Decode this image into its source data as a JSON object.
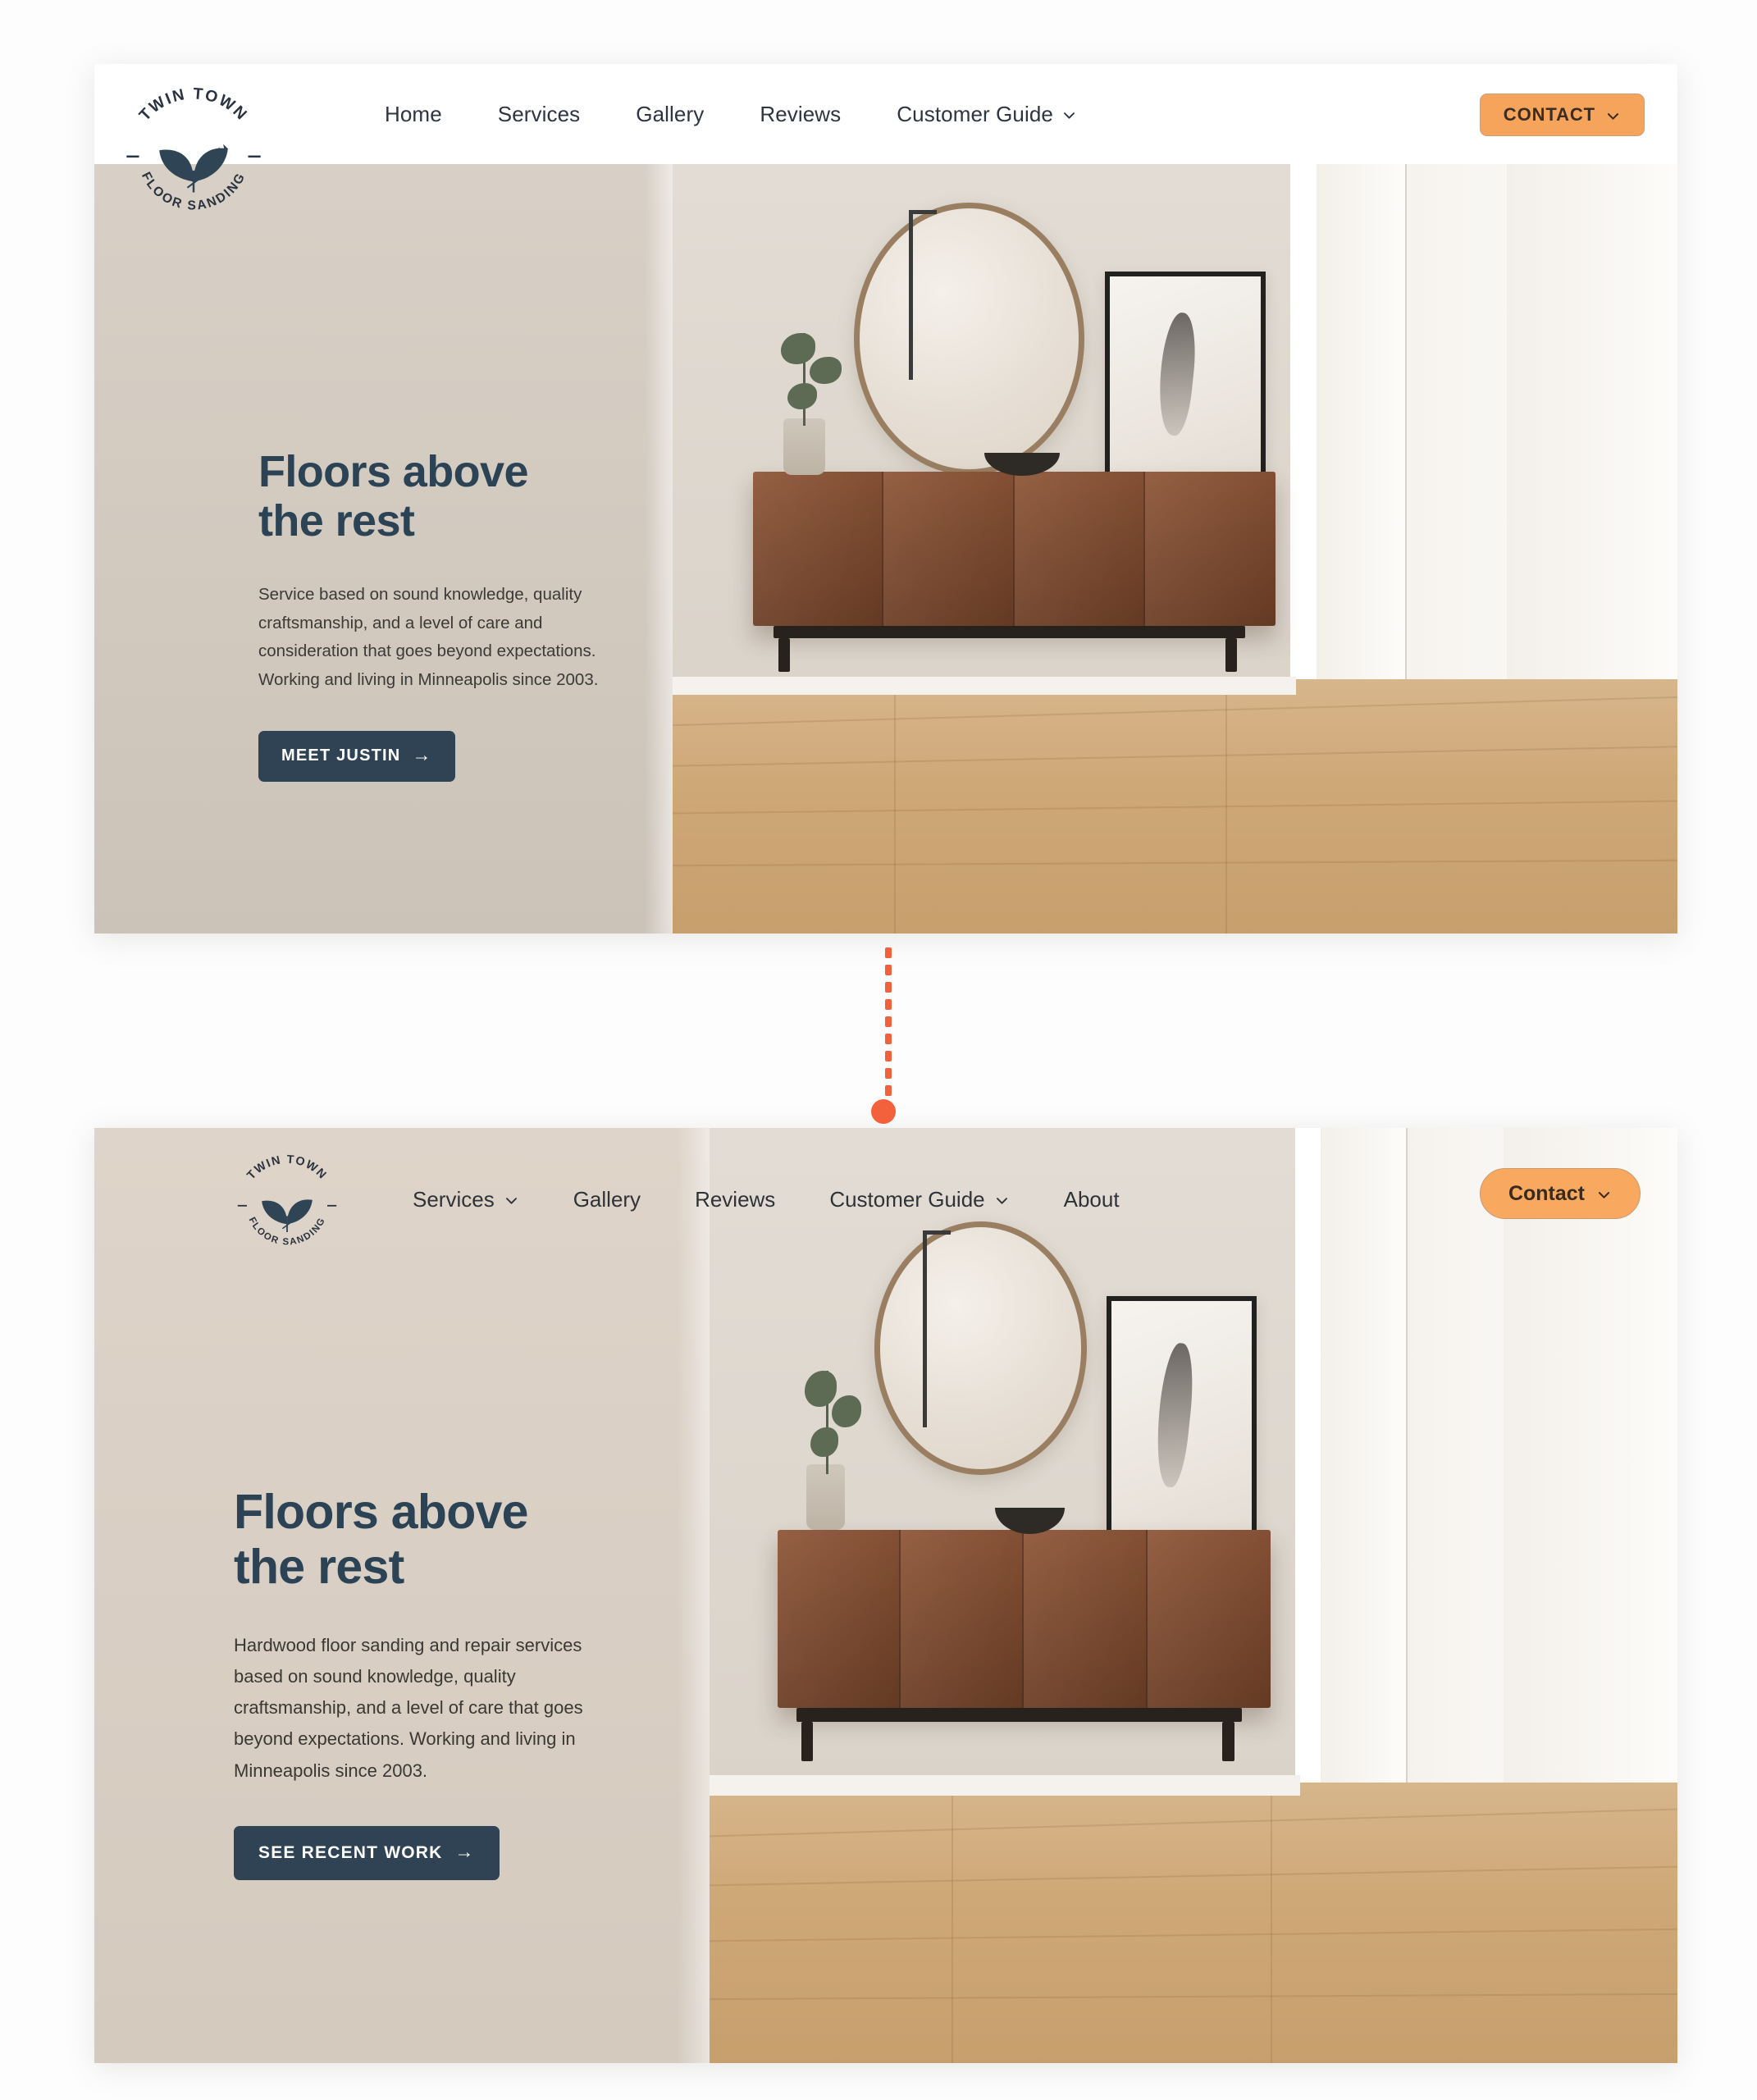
{
  "brand": {
    "name_top": "TWIN TOWN",
    "name_bottom": "FLOOR SANDING",
    "logo_icon": "leaf-emblem-icon"
  },
  "colors": {
    "page_background": "#fdfdfd",
    "heading": "#2c4356",
    "dark_button": "#2f4355",
    "accent_orange": "#f6a35b",
    "connector_orange": "#f2603c",
    "panel_beige": "#d8d0c6"
  },
  "section_top": {
    "nav": {
      "items": [
        {
          "label": "Home",
          "has_dropdown": false
        },
        {
          "label": "Services",
          "has_dropdown": false
        },
        {
          "label": "Gallery",
          "has_dropdown": false
        },
        {
          "label": "Reviews",
          "has_dropdown": false
        },
        {
          "label": "Customer Guide",
          "has_dropdown": true
        }
      ],
      "cta": {
        "label": "CONTACT",
        "has_dropdown": true,
        "icon": "chevron-down-icon"
      }
    },
    "hero": {
      "title_line1": "Floors above",
      "title_line2": "the rest",
      "paragraph": "Service based on sound knowledge, quality craftsmanship, and a level of care and consideration that goes beyond expectations. Working and living in Minneapolis since 2003.",
      "cta_label": "MEET JUSTIN",
      "cta_icon": "arrow-right-icon"
    }
  },
  "connector": {
    "style": "dotted-vertical-line",
    "end_marker": "filled-circle",
    "color": "#f2603c"
  },
  "section_bottom": {
    "nav": {
      "items": [
        {
          "label": "Services",
          "has_dropdown": true
        },
        {
          "label": "Gallery",
          "has_dropdown": false
        },
        {
          "label": "Reviews",
          "has_dropdown": false
        },
        {
          "label": "Customer Guide",
          "has_dropdown": true
        },
        {
          "label": "About",
          "has_dropdown": false
        }
      ],
      "cta": {
        "label": "Contact",
        "has_dropdown": true,
        "icon": "chevron-down-icon"
      }
    },
    "hero": {
      "title_line1": "Floors above",
      "title_line2": "the rest",
      "paragraph": "Hardwood floor sanding and repair services based on sound knowledge, quality craftsmanship, and a level of care that goes beyond expectations. Working and living in Minneapolis since 2003.",
      "cta_label": "SEE RECENT WORK",
      "cta_icon": "arrow-right-icon"
    }
  },
  "photo": {
    "alt": "hallway-interior-with-mirror-credenza-and-hardwood-floor"
  }
}
